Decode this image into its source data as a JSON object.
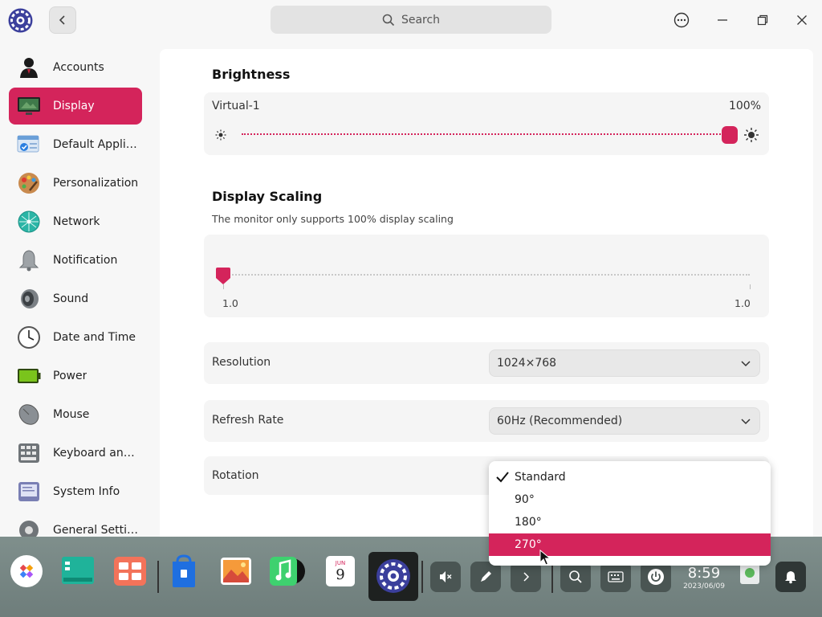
{
  "titlebar": {
    "search_placeholder": "Search"
  },
  "sidebar": {
    "items": [
      {
        "label": "Accounts",
        "icon": "user-icon"
      },
      {
        "label": "Display",
        "icon": "monitor-icon",
        "active": true
      },
      {
        "label": "Default Applic...",
        "icon": "default-apps-icon"
      },
      {
        "label": "Personalization",
        "icon": "palette-icon"
      },
      {
        "label": "Network",
        "icon": "network-icon"
      },
      {
        "label": "Notification",
        "icon": "bell-icon"
      },
      {
        "label": "Sound",
        "icon": "speaker-icon"
      },
      {
        "label": "Date and Time",
        "icon": "clock-icon"
      },
      {
        "label": "Power",
        "icon": "battery-icon"
      },
      {
        "label": "Mouse",
        "icon": "mouse-icon"
      },
      {
        "label": "Keyboard and ...",
        "icon": "keyboard-icon"
      },
      {
        "label": "System Info",
        "icon": "system-info-icon"
      },
      {
        "label": "General Settin...",
        "icon": "gear-icon"
      }
    ]
  },
  "brightness": {
    "title": "Brightness",
    "monitor": "Virtual-1",
    "value_label": "100%",
    "value": 1.0
  },
  "scaling": {
    "title": "Display Scaling",
    "note": "The monitor only supports 100% display scaling",
    "min_label": "1.0",
    "max_label": "1.0",
    "value": 0.0
  },
  "resolution": {
    "label": "Resolution",
    "value": "1024×768"
  },
  "refresh": {
    "label": "Refresh Rate",
    "value": "60Hz (Recommended)"
  },
  "rotation": {
    "label": "Rotation",
    "options": [
      "Standard",
      "90°",
      "180°",
      "270°"
    ],
    "checked": "Standard",
    "highlighted": "270°"
  },
  "dock": {
    "calendar_month": "JUN",
    "calendar_day": "9",
    "clock_time": "8:59",
    "clock_date": "2023/06/09"
  },
  "colors": {
    "accent": "#d4245b"
  }
}
